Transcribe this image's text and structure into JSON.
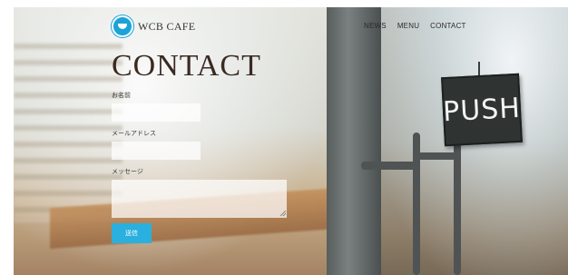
{
  "header": {
    "logo_text": "WCB CAFE",
    "nav": [
      "NEWS",
      "MENU",
      "CONTACT"
    ]
  },
  "main": {
    "title": "CONTACT",
    "fields": {
      "name_label": "お名前",
      "email_label": "メールアドレス",
      "message_label": "メッセージ"
    },
    "submit_label": "送信"
  },
  "background": {
    "sign_text": "PUSH"
  },
  "colors": {
    "accent": "#2ab0df",
    "title": "#3a2a22"
  }
}
